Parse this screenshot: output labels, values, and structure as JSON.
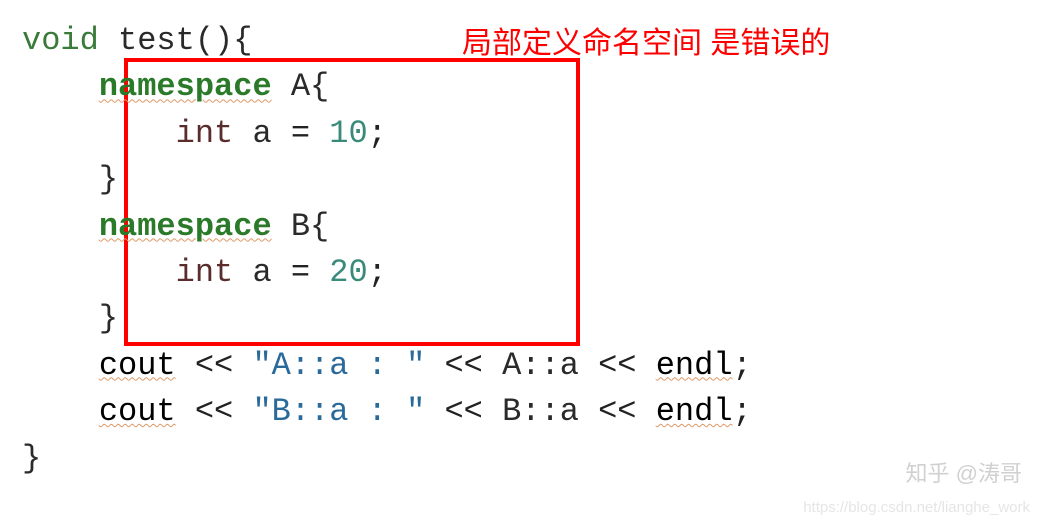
{
  "annotation": {
    "error_label": "局部定义命名空间 是错误的"
  },
  "code": {
    "line1": {
      "kw": "void",
      "rest": " test(){"
    },
    "line2": {
      "indent": "    ",
      "kw": "namespace",
      "rest": " A{"
    },
    "line3": {
      "indent": "        ",
      "kw": "int",
      "var": " a ",
      "op": "=",
      "sp": " ",
      "val": "10",
      "semi": ";"
    },
    "line4": {
      "indent": "    ",
      "brace": "}"
    },
    "line5": {
      "indent": "    ",
      "kw": "namespace",
      "rest": " B{"
    },
    "line6": {
      "indent": "        ",
      "kw": "int",
      "var": " a ",
      "op": "=",
      "sp": " ",
      "val": "20",
      "semi": ";"
    },
    "line7": {
      "indent": "    ",
      "brace": "}"
    },
    "line8": {
      "indent": "    ",
      "cout": "cout",
      "sp1": " ",
      "op1": "<<",
      "sp2": " ",
      "str": "\"A::a : \"",
      "sp3": " ",
      "op2": "<<",
      "sp4": " ",
      "expr": "A::a",
      "sp5": " ",
      "op3": "<<",
      "sp6": " ",
      "endl": "endl",
      "semi": ";"
    },
    "line9": {
      "indent": "    ",
      "cout": "cout",
      "sp1": " ",
      "op1": "<<",
      "sp2": " ",
      "str": "\"B::a : \"",
      "sp3": " ",
      "op2": "<<",
      "sp4": " ",
      "expr": "B::a",
      "sp5": " ",
      "op3": "<<",
      "sp6": " ",
      "endl": "endl",
      "semi": ";"
    },
    "line10": {
      "brace": "}"
    }
  },
  "watermark": {
    "text1": "知乎 @涛哥",
    "text2": "https://blog.csdn.net/lianghe_work"
  }
}
